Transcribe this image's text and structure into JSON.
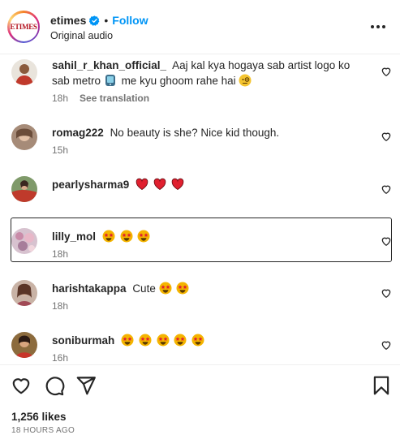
{
  "header": {
    "brand_logo_text": "ETIMES",
    "account_name": "etimes",
    "separator": "•",
    "follow_label": "Follow",
    "audio_label": "Original audio"
  },
  "comments": [
    {
      "username": "sahil_r_khan_official_",
      "text": "Aaj kal kya hogaya sab artist logo ko sab metro",
      "text_after": "me kyu ghoom rahe hai",
      "emojis": [
        "mobile-phone",
        "face-with-monocle"
      ],
      "time": "18h",
      "translate_label": "See translation"
    },
    {
      "username": "romag222",
      "text": "No beauty is she? Nice kid though.",
      "emojis": [],
      "time": "15h"
    },
    {
      "username": "pearlysharma9",
      "text": "",
      "emojis": [
        "red-heart",
        "red-heart",
        "red-heart"
      ],
      "time": ""
    },
    {
      "username": "lilly_mol",
      "text": "",
      "emojis": [
        "star-struck",
        "star-struck",
        "star-struck"
      ],
      "time": "18h"
    },
    {
      "username": "harishtakappa",
      "text": "Cute",
      "emojis": [
        "star-struck",
        "star-struck"
      ],
      "time": "18h"
    },
    {
      "username": "soniburmah",
      "text": "",
      "emojis": [
        "star-struck",
        "star-struck",
        "star-struck",
        "star-struck",
        "star-struck"
      ],
      "time": "16h"
    }
  ],
  "post": {
    "likes": "1,256 likes",
    "time_ago": "18 HOURS AGO"
  },
  "colors": {
    "accent": "#0095f6",
    "text": "#262626",
    "muted": "#737373",
    "brand_red": "#b3121e"
  },
  "icons": [
    "verified-badge-icon",
    "more-options-icon",
    "heart-icon",
    "comment-icon",
    "share-icon",
    "bookmark-icon"
  ]
}
